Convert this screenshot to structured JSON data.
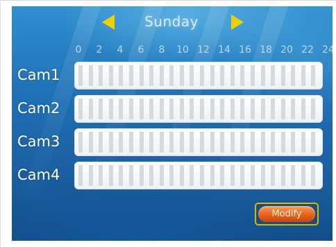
{
  "schedule": {
    "day": "Sunday",
    "hour_labels": [
      "0",
      "2",
      "4",
      "6",
      "8",
      "10",
      "12",
      "14",
      "16",
      "18",
      "20",
      "22",
      "24"
    ],
    "cameras": [
      {
        "label": "Cam1"
      },
      {
        "label": "Cam2"
      },
      {
        "label": "Cam3"
      },
      {
        "label": "Cam4"
      }
    ],
    "modify_label": "Modify"
  },
  "colors": {
    "accent_arrow": "#f0d000",
    "button_orange": "#e8661c",
    "background_blue": "#1f6fb5"
  },
  "icons": {
    "prev": "triangle-left-icon",
    "next": "triangle-right-icon"
  }
}
